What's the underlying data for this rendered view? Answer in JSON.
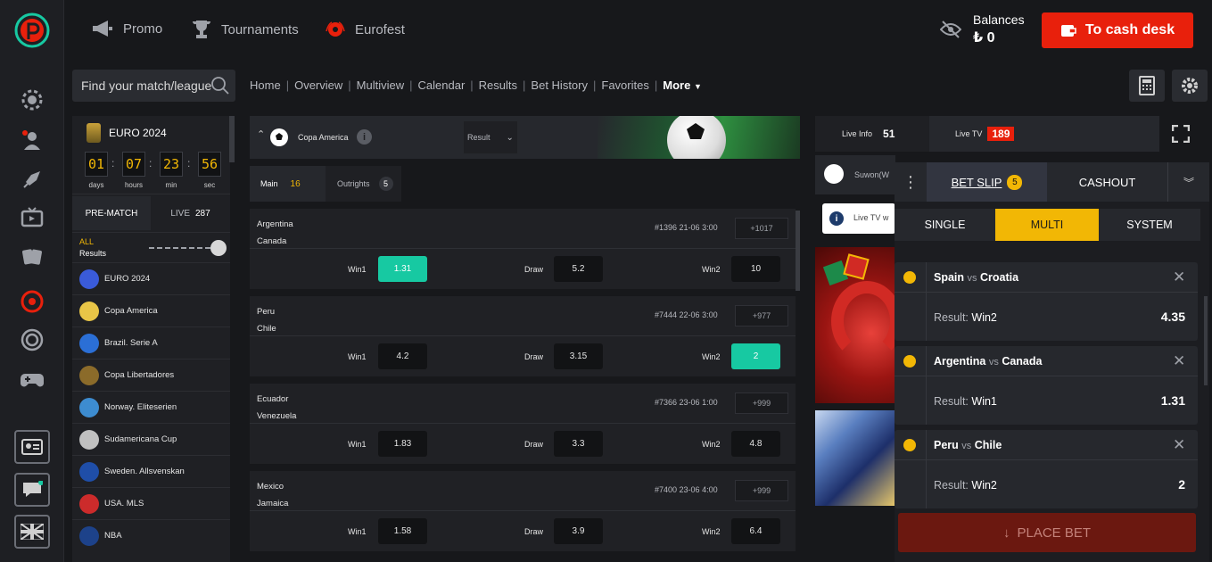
{
  "topnav": {
    "promo": "Promo",
    "tournaments": "Tournaments",
    "eurofest": "Eurofest"
  },
  "balance": {
    "label": "Balances",
    "value": "₺ 0"
  },
  "cash_desk_label": "To cash desk",
  "search": {
    "placeholder": "Find your match/league"
  },
  "breadcrumbs": [
    "Home",
    "Overview",
    "Multiview",
    "Calendar",
    "Results",
    "Bet History",
    "Favorites"
  ],
  "more_label": "More",
  "euro": {
    "title": "EURO 2024",
    "days": "01",
    "hours": "07",
    "min": "23",
    "sec": "56",
    "days_lbl": "days",
    "hours_lbl": "hours",
    "min_lbl": "min",
    "sec_lbl": "sec"
  },
  "left_tabs": {
    "prematch": "PRE-MATCH",
    "live": "LIVE",
    "live_count": "287"
  },
  "all_results": {
    "all": "ALL",
    "results": "Results"
  },
  "leagues": [
    {
      "name": "EURO 2024",
      "icon": "euro-icon",
      "color": "#3a5bd9"
    },
    {
      "name": "Copa America",
      "icon": "copa-america-icon",
      "color": "#e8c547"
    },
    {
      "name": "Brazil. Serie A",
      "icon": "brazil-icon",
      "color": "#2b6fd6"
    },
    {
      "name": "Copa Libertadores",
      "icon": "libertadores-icon",
      "color": "#8b6b2a"
    },
    {
      "name": "Norway. Eliteserien",
      "icon": "norway-icon",
      "color": "#3d8cd0"
    },
    {
      "name": "Sudamericana Cup",
      "icon": "sudamericana-icon",
      "color": "#c0c0c0"
    },
    {
      "name": "Sweden. Allsvenskan",
      "icon": "sweden-icon",
      "color": "#1f4ea8"
    },
    {
      "name": "USA. MLS",
      "icon": "mls-icon",
      "color": "#cc2b2b"
    },
    {
      "name": "NBA",
      "icon": "nba-icon",
      "color": "#1d428a"
    }
  ],
  "center": {
    "league": "Copa America",
    "market_select": "Result",
    "tabs": [
      {
        "label": "Main",
        "count": "16"
      },
      {
        "label": "Outrights",
        "count": "5"
      }
    ],
    "odd_labels": [
      "Win1",
      "Draw",
      "Win2"
    ],
    "matches": [
      {
        "home": "Argentina",
        "away": "Canada",
        "id": "#1396",
        "date": "21-06",
        "time": "3:00",
        "more": "+1017",
        "odds": [
          "1.31",
          "5.2",
          "10"
        ],
        "selected": 0
      },
      {
        "home": "Peru",
        "away": "Chile",
        "id": "#7444",
        "date": "22-06",
        "time": "3:00",
        "more": "+977",
        "odds": [
          "4.2",
          "3.15",
          "2"
        ],
        "selected": 2
      },
      {
        "home": "Ecuador",
        "away": "Venezuela",
        "id": "#7366",
        "date": "23-06",
        "time": "1:00",
        "more": "+999",
        "odds": [
          "1.83",
          "3.3",
          "4.8"
        ],
        "selected": -1
      },
      {
        "home": "Mexico",
        "away": "Jamaica",
        "id": "#7400",
        "date": "23-06",
        "time": "4:00",
        "more": "+999",
        "odds": [
          "1.58",
          "3.9",
          "6.4"
        ],
        "selected": -1
      }
    ]
  },
  "live": {
    "info_label": "Live Info",
    "info_count": "51",
    "tv_label": "Live TV",
    "tv_count": "189",
    "partial_team": "Suwon(W",
    "partial_tv": "Live TV w"
  },
  "betslip": {
    "tab_betslip": "BET SLIP",
    "betslip_count": "5",
    "tab_cashout": "CASHOUT",
    "modes": [
      "SINGLE",
      "MULTI",
      "SYSTEM"
    ],
    "active_mode": 1,
    "vs": "vs",
    "result_label": "Result:",
    "items": [
      {
        "home": "Spain",
        "away": "Croatia",
        "result": "Win2",
        "odd": "4.35"
      },
      {
        "home": "Argentina",
        "away": "Canada",
        "result": "Win1",
        "odd": "1.31"
      },
      {
        "home": "Peru",
        "away": "Chile",
        "result": "Win2",
        "odd": "2"
      }
    ],
    "place_bet": "PLACE BET"
  },
  "colors": {
    "accent_red": "#e8200c",
    "accent_yellow": "#f2b705",
    "selected_odd": "#17c9a2",
    "bg": "#17181b"
  }
}
